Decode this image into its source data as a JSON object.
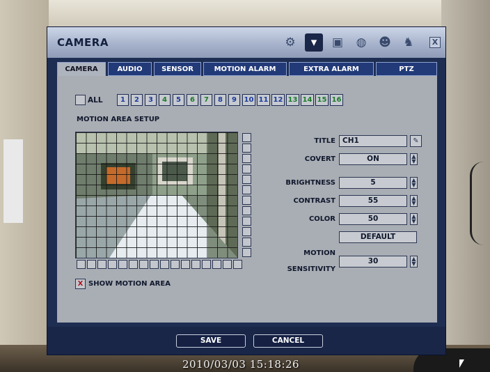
{
  "window": {
    "title": "CAMERA"
  },
  "toolbar_icons": [
    "gear-icon",
    "camera-icon",
    "display-icon",
    "network-icon",
    "user-icon",
    "recording-icon",
    "close-icon"
  ],
  "close_label": "X",
  "tabs": [
    {
      "label": "CAMERA",
      "active": true
    },
    {
      "label": "AUDIO"
    },
    {
      "label": "SENSOR"
    },
    {
      "label": "MOTION ALARM"
    },
    {
      "label": "EXTRA ALARM"
    },
    {
      "label": "PTZ"
    }
  ],
  "channels": {
    "all_label": "ALL",
    "buttons": [
      "1",
      "2",
      "3",
      "4",
      "5",
      "6",
      "7",
      "8",
      "9",
      "10",
      "11",
      "12",
      "13",
      "14",
      "15",
      "16"
    ]
  },
  "motion": {
    "section_label": "MOTION AREA SETUP",
    "show_label": "SHOW MOTION AREA",
    "show_checked_mark": "X"
  },
  "settings": {
    "title_label": "TITLE",
    "title_value": "CH1",
    "covert_label": "COVERT",
    "covert_value": "ON",
    "brightness_label": "BRIGHTNESS",
    "brightness_value": "5",
    "contrast_label": "CONTRAST",
    "contrast_value": "55",
    "color_label": "COLOR",
    "color_value": "50",
    "default_label": "DEFAULT",
    "motion_sensitivity_label_1": "MOTION",
    "motion_sensitivity_label_2": "SENSITIVITY",
    "motion_sensitivity_value": "30"
  },
  "footer": {
    "save_label": "SAVE",
    "cancel_label": "CANCEL"
  },
  "osd": {
    "datetime": "2010/03/03 15:18:26"
  },
  "colors": {
    "panel": "#1e2d52",
    "content": "#a9adb4",
    "tab": "#223a78",
    "channel_text": "#1d3a9a",
    "channel_green_text": "#1d7a2a"
  }
}
